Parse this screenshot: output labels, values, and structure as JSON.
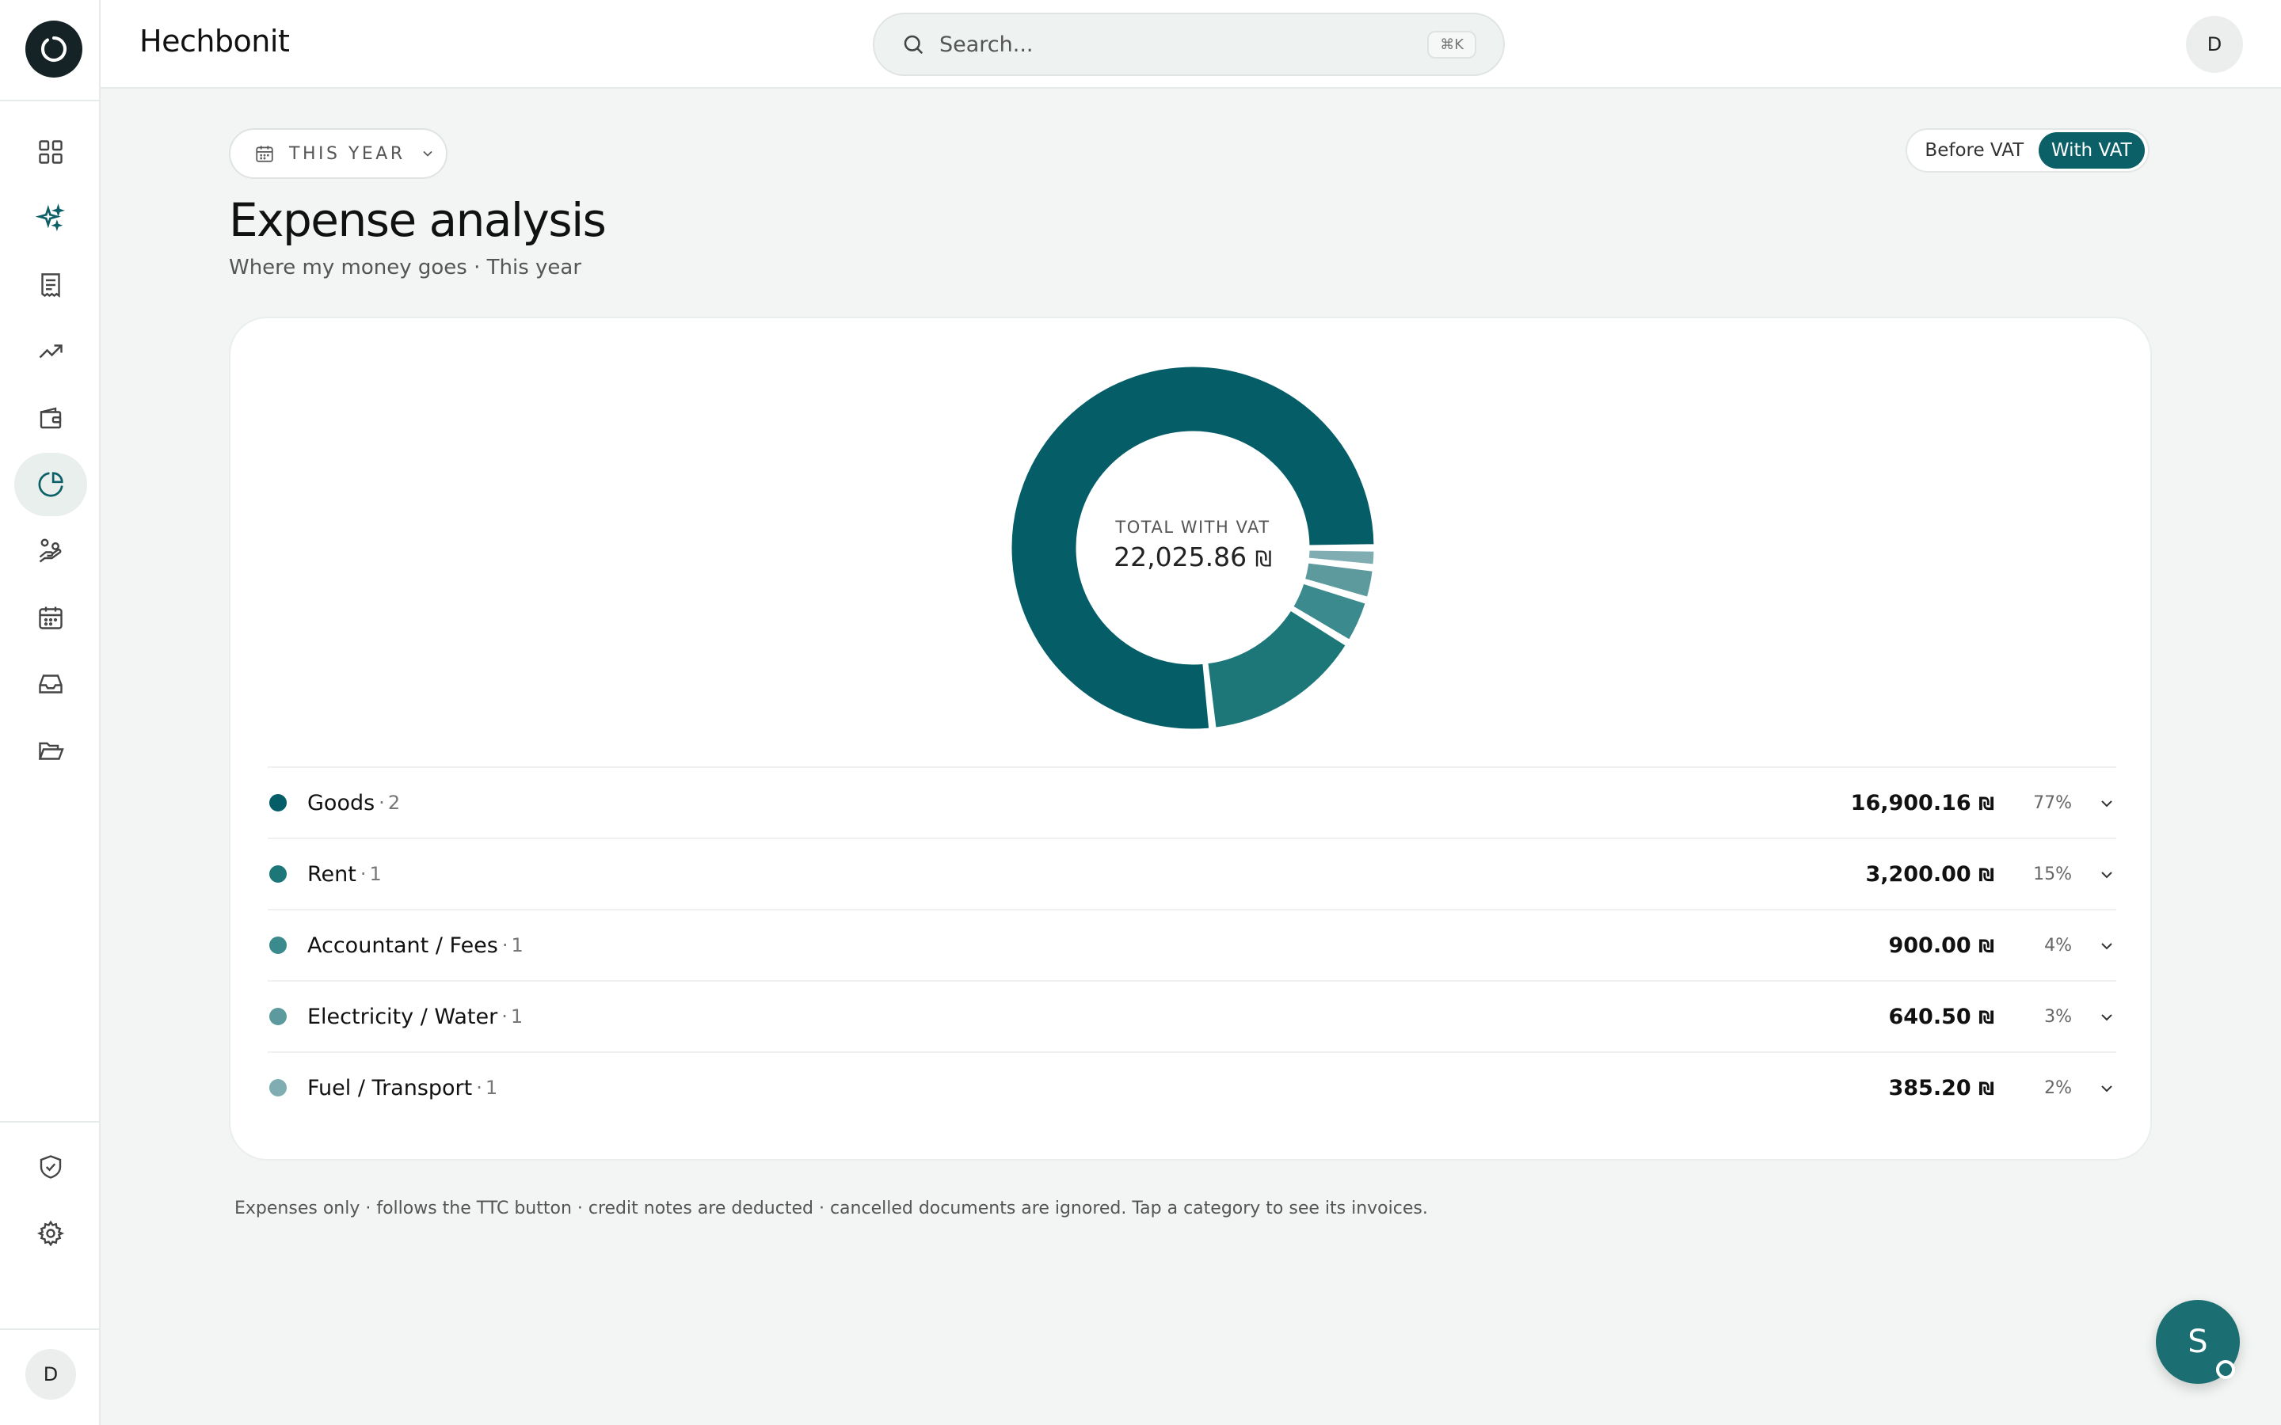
{
  "app": {
    "title": "Hechbonit",
    "user_initial": "D"
  },
  "search": {
    "placeholder": "Search...",
    "shortcut": "⌘K"
  },
  "period": {
    "label": "THIS YEAR"
  },
  "vat_toggle": {
    "before": "Before VAT",
    "with": "With VAT",
    "selected": "With VAT"
  },
  "page": {
    "title": "Expense analysis",
    "subtitle": "Where my money goes · This year"
  },
  "summary": {
    "label": "TOTAL WITH VAT",
    "total": "22,025.86"
  },
  "currency_symbol": "₪",
  "categories": [
    {
      "name": "Goods",
      "count": "2",
      "amount": "16,900.16",
      "percent": "77%",
      "color": "#055e67"
    },
    {
      "name": "Rent",
      "count": "1",
      "amount": "3,200.00",
      "percent": "15%",
      "color": "#1d7779"
    },
    {
      "name": "Accountant / Fees",
      "count": "1",
      "amount": "900.00",
      "percent": "4%",
      "color": "#3b8a8d"
    },
    {
      "name": "Electricity / Water",
      "count": "1",
      "amount": "640.50",
      "percent": "3%",
      "color": "#5d9a9e"
    },
    {
      "name": "Fuel / Transport",
      "count": "1",
      "amount": "385.20",
      "percent": "2%",
      "color": "#7fadb1"
    }
  ],
  "chart_data": {
    "type": "pie",
    "categories": [
      "Goods",
      "Rent",
      "Accountant / Fees",
      "Electricity / Water",
      "Fuel / Transport"
    ],
    "values": [
      16900.16,
      3200.0,
      900.0,
      640.5,
      385.2
    ],
    "colors": [
      "#055e67",
      "#1d7779",
      "#3b8a8d",
      "#5d9a9e",
      "#7fadb1"
    ],
    "total": 22025.86
  },
  "footnote": "Expenses only · follows the TTC button · credit notes are deducted · cancelled documents are ignored. Tap a category to see its invoices.",
  "assistant": {
    "initial": "S"
  }
}
